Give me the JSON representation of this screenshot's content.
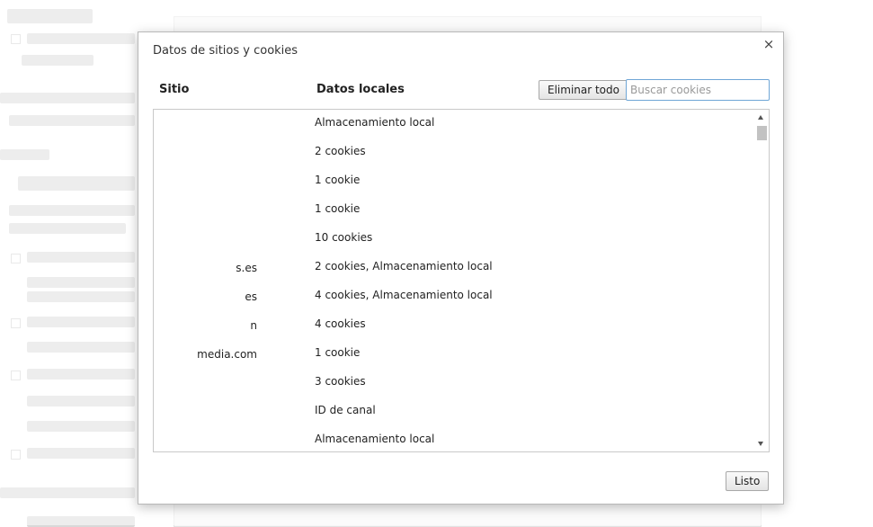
{
  "dialog": {
    "title": "Datos de sitios y cookies",
    "close_icon": "×",
    "headers": {
      "site": "Sitio",
      "data": "Datos locales"
    },
    "delete_all_label": "Eliminar todo",
    "search_placeholder": "Buscar cookies",
    "done_label": "Listo",
    "rows": [
      {
        "site": "",
        "data": "Almacenamiento local"
      },
      {
        "site": "",
        "data": "2 cookies"
      },
      {
        "site": "",
        "data": "1 cookie"
      },
      {
        "site": "",
        "data": "1 cookie"
      },
      {
        "site": "",
        "data": "10 cookies"
      },
      {
        "site": "s.es",
        "data": "2 cookies, Almacenamiento local"
      },
      {
        "site": "es",
        "data": "4 cookies, Almacenamiento local"
      },
      {
        "site": "n",
        "data": "4 cookies"
      },
      {
        "site": "media.com",
        "data": "1 cookie"
      },
      {
        "site": "",
        "data": "3 cookies"
      },
      {
        "site": "",
        "data": "ID de canal"
      },
      {
        "site": "",
        "data": "Almacenamiento local"
      }
    ]
  }
}
